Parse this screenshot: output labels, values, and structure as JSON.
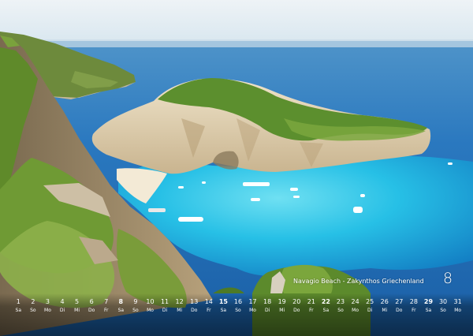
{
  "caption": "Navagio Beach - Zakynthos Griechenland",
  "month_number": "8",
  "calendar": {
    "days": [
      {
        "n": "1",
        "wd": "Sa"
      },
      {
        "n": "2",
        "wd": "So"
      },
      {
        "n": "3",
        "wd": "Mo"
      },
      {
        "n": "4",
        "wd": "Di"
      },
      {
        "n": "5",
        "wd": "Mi"
      },
      {
        "n": "6",
        "wd": "Do"
      },
      {
        "n": "7",
        "wd": "Fr"
      },
      {
        "n": "8",
        "wd": "Sa"
      },
      {
        "n": "9",
        "wd": "So"
      },
      {
        "n": "10",
        "wd": "Mo"
      },
      {
        "n": "11",
        "wd": "Di"
      },
      {
        "n": "12",
        "wd": "Mi"
      },
      {
        "n": "13",
        "wd": "Do"
      },
      {
        "n": "14",
        "wd": "Fr"
      },
      {
        "n": "15",
        "wd": "Sa"
      },
      {
        "n": "16",
        "wd": "So"
      },
      {
        "n": "17",
        "wd": "Mo"
      },
      {
        "n": "18",
        "wd": "Di"
      },
      {
        "n": "19",
        "wd": "Mi"
      },
      {
        "n": "20",
        "wd": "Do"
      },
      {
        "n": "21",
        "wd": "Fr"
      },
      {
        "n": "22",
        "wd": "Sa"
      },
      {
        "n": "23",
        "wd": "So"
      },
      {
        "n": "24",
        "wd": "Mo"
      },
      {
        "n": "25",
        "wd": "Di"
      },
      {
        "n": "26",
        "wd": "Mi"
      },
      {
        "n": "27",
        "wd": "Do"
      },
      {
        "n": "28",
        "wd": "Fr"
      },
      {
        "n": "29",
        "wd": "Sa"
      },
      {
        "n": "30",
        "wd": "So"
      },
      {
        "n": "31",
        "wd": "Mo"
      }
    ],
    "bold_days": [
      "8",
      "15",
      "22",
      "29"
    ]
  },
  "colors": {
    "sky": "#dfeaf1",
    "sea_deep": "#1d63a8",
    "lagoon": "#2fbfe3",
    "cliff": "#e7d9bd",
    "vegetation": "#5f8e2c"
  }
}
